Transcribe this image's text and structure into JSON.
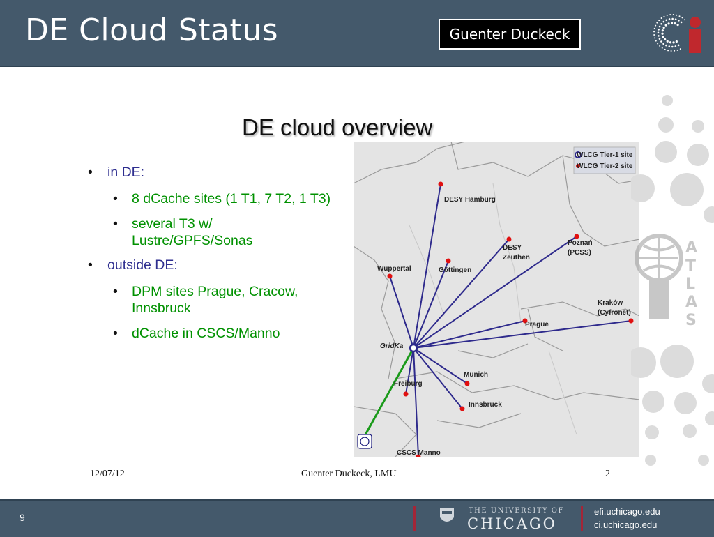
{
  "header": {
    "title": "DE Cloud Status",
    "author": "Guenter Duckeck",
    "logo_icon": "ci-logo-icon"
  },
  "slide": {
    "heading": "DE cloud overview",
    "bullets": [
      {
        "text": "in DE:",
        "sub": [
          "8 dCache sites (1 T1, 7 T2, 1 T3)",
          "several T3 w/ Lustre/GPFS/Sonas"
        ]
      },
      {
        "text": "outside DE:",
        "sub": [
          "DPM sites Prague, Cracow, Innsbruck",
          "dCache in CSCS/Manno"
        ]
      }
    ],
    "footer": {
      "date": "12/07/12",
      "author": "Guenter Duckeck, LMU",
      "page": "2"
    }
  },
  "map": {
    "legend": {
      "tier1": "WLCG Tier-1 site",
      "tier2": "WLCG Tier-2 site"
    },
    "hub_label": "GridKa",
    "sites": [
      {
        "name": "DESY Hamburg"
      },
      {
        "name": "Wuppertal"
      },
      {
        "name": "Göttingen"
      },
      {
        "name": "DESY"
      },
      {
        "name": "Zeuthen"
      },
      {
        "name": "Poznań"
      },
      {
        "name": "(PCSS)"
      },
      {
        "name": "Kraków"
      },
      {
        "name": "(Cyfronet)"
      },
      {
        "name": "Prague"
      },
      {
        "name": "Munich"
      },
      {
        "name": "Freiburg"
      },
      {
        "name": "Innsbruck"
      },
      {
        "name": "CSCS Manno"
      }
    ],
    "colors": {
      "link": "#2e2a8c",
      "cern_link": "#1a9a1a",
      "tier2_dot": "#e01010"
    }
  },
  "footer": {
    "page_number": "9",
    "uc_small": "THE UNIVERSITY OF",
    "uc_big": "CHICAGO",
    "links": [
      "efi.uchicago.edu",
      "ci.uchicago.edu"
    ]
  }
}
